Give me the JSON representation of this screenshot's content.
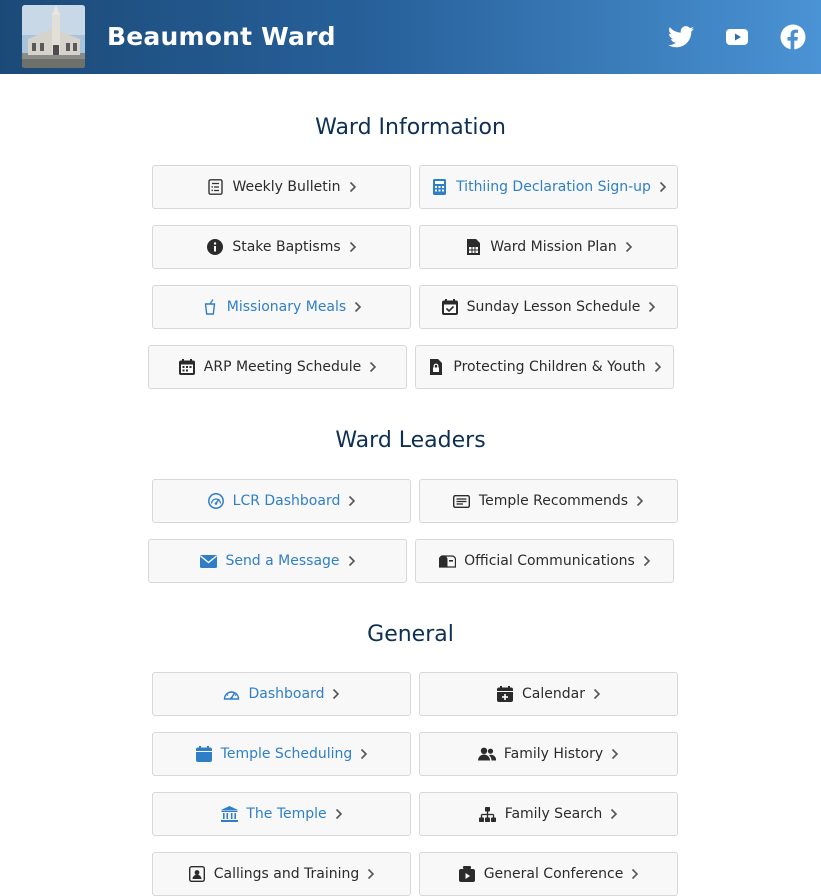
{
  "header": {
    "title": "Beaumont Ward",
    "logo_icon": "church-photo",
    "social": [
      "twitter-icon",
      "youtube-icon",
      "facebook-icon"
    ]
  },
  "sections": [
    {
      "title": "Ward Information",
      "items": [
        {
          "label": "Weekly Bulletin",
          "icon": "bulletin-icon",
          "color": "dark"
        },
        {
          "label": "Tithiing Declaration Sign-up",
          "icon": "calculator-icon",
          "color": "blue"
        },
        {
          "label": "Stake Baptisms",
          "icon": "info-icon",
          "color": "dark"
        },
        {
          "label": "Ward Mission Plan",
          "icon": "spreadsheet-icon",
          "color": "dark"
        },
        {
          "label": "Missionary Meals",
          "icon": "cup-icon",
          "color": "blue"
        },
        {
          "label": "Sunday Lesson Schedule",
          "icon": "calendar-check-icon",
          "color": "dark"
        },
        {
          "label": "ARP Meeting Schedule",
          "icon": "calendar-icon",
          "color": "dark"
        },
        {
          "label": "Protecting Children & Youth",
          "icon": "lock-file-icon",
          "color": "dark"
        }
      ]
    },
    {
      "title": "Ward Leaders",
      "items": [
        {
          "label": "LCR Dashboard",
          "icon": "gauge-icon",
          "color": "blue"
        },
        {
          "label": "Temple Recommends",
          "icon": "card-icon",
          "color": "dark"
        },
        {
          "label": "Send a Message",
          "icon": "envelope-icon",
          "color": "blue"
        },
        {
          "label": "Official Communications",
          "icon": "mailbox-icon",
          "color": "dark"
        }
      ]
    },
    {
      "title": "General",
      "items": [
        {
          "label": "Dashboard",
          "icon": "dashboard-icon",
          "color": "blue"
        },
        {
          "label": "Calendar",
          "icon": "calendar-plus-icon",
          "color": "dark"
        },
        {
          "label": "Temple Scheduling",
          "icon": "calendar-blue-icon",
          "color": "blue"
        },
        {
          "label": "Family History",
          "icon": "people-icon",
          "color": "dark"
        },
        {
          "label": "The Temple",
          "icon": "temple-icon",
          "color": "blue"
        },
        {
          "label": "Family Search",
          "icon": "tree-icon",
          "color": "dark"
        },
        {
          "label": "Callings and Training",
          "icon": "id-badge-icon",
          "color": "dark"
        },
        {
          "label": "General Conference",
          "icon": "video-icon",
          "color": "dark"
        }
      ]
    }
  ]
}
